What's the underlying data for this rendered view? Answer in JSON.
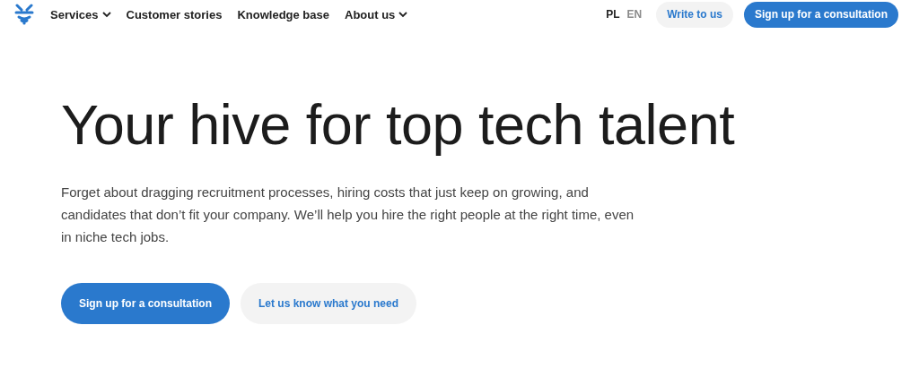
{
  "nav": {
    "items": [
      {
        "label": "Services",
        "kind": "dropdown"
      },
      {
        "label": "Customer stories",
        "kind": "link"
      },
      {
        "label": "Knowledge base",
        "kind": "link"
      },
      {
        "label": "About us",
        "kind": "dropdown"
      }
    ],
    "languages": [
      {
        "label": "PL",
        "selected": true
      },
      {
        "label": "EN",
        "selected": false
      }
    ],
    "buttons": [
      {
        "label": "Write to us",
        "kind": "secondary"
      },
      {
        "label": "Sign up for a consultation",
        "kind": "primary"
      }
    ]
  },
  "hero": {
    "title": "Your hive for top tech talent",
    "text": "Forget about dragging recruitment processes, hiring costs that just keep on growing, and candidates that don’t fit your company. We’ll help you hire the right people at the right time, even in niche tech jobs.",
    "buttons": [
      {
        "label": "Sign up for a consultation",
        "kind": "primary"
      },
      {
        "label": "Let us know what you need",
        "kind": "secondary"
      }
    ]
  }
}
